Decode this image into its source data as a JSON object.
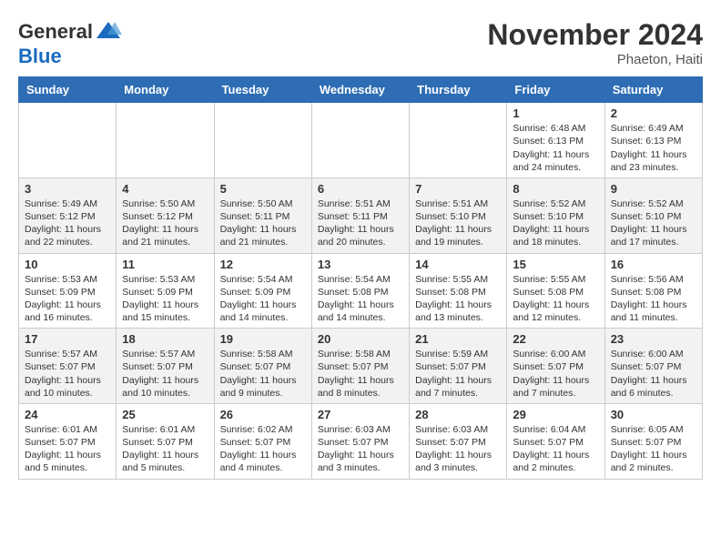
{
  "header": {
    "logo_line1": "General",
    "logo_line2": "Blue",
    "month_title": "November 2024",
    "location": "Phaeton, Haiti"
  },
  "weekdays": [
    "Sunday",
    "Monday",
    "Tuesday",
    "Wednesday",
    "Thursday",
    "Friday",
    "Saturday"
  ],
  "weeks": [
    [
      {
        "day": "",
        "detail": ""
      },
      {
        "day": "",
        "detail": ""
      },
      {
        "day": "",
        "detail": ""
      },
      {
        "day": "",
        "detail": ""
      },
      {
        "day": "",
        "detail": ""
      },
      {
        "day": "1",
        "detail": "Sunrise: 6:48 AM\nSunset: 6:13 PM\nDaylight: 11 hours\nand 24 minutes."
      },
      {
        "day": "2",
        "detail": "Sunrise: 6:49 AM\nSunset: 6:13 PM\nDaylight: 11 hours\nand 23 minutes."
      }
    ],
    [
      {
        "day": "3",
        "detail": "Sunrise: 5:49 AM\nSunset: 5:12 PM\nDaylight: 11 hours\nand 22 minutes."
      },
      {
        "day": "4",
        "detail": "Sunrise: 5:50 AM\nSunset: 5:12 PM\nDaylight: 11 hours\nand 21 minutes."
      },
      {
        "day": "5",
        "detail": "Sunrise: 5:50 AM\nSunset: 5:11 PM\nDaylight: 11 hours\nand 21 minutes."
      },
      {
        "day": "6",
        "detail": "Sunrise: 5:51 AM\nSunset: 5:11 PM\nDaylight: 11 hours\nand 20 minutes."
      },
      {
        "day": "7",
        "detail": "Sunrise: 5:51 AM\nSunset: 5:10 PM\nDaylight: 11 hours\nand 19 minutes."
      },
      {
        "day": "8",
        "detail": "Sunrise: 5:52 AM\nSunset: 5:10 PM\nDaylight: 11 hours\nand 18 minutes."
      },
      {
        "day": "9",
        "detail": "Sunrise: 5:52 AM\nSunset: 5:10 PM\nDaylight: 11 hours\nand 17 minutes."
      }
    ],
    [
      {
        "day": "10",
        "detail": "Sunrise: 5:53 AM\nSunset: 5:09 PM\nDaylight: 11 hours\nand 16 minutes."
      },
      {
        "day": "11",
        "detail": "Sunrise: 5:53 AM\nSunset: 5:09 PM\nDaylight: 11 hours\nand 15 minutes."
      },
      {
        "day": "12",
        "detail": "Sunrise: 5:54 AM\nSunset: 5:09 PM\nDaylight: 11 hours\nand 14 minutes."
      },
      {
        "day": "13",
        "detail": "Sunrise: 5:54 AM\nSunset: 5:08 PM\nDaylight: 11 hours\nand 14 minutes."
      },
      {
        "day": "14",
        "detail": "Sunrise: 5:55 AM\nSunset: 5:08 PM\nDaylight: 11 hours\nand 13 minutes."
      },
      {
        "day": "15",
        "detail": "Sunrise: 5:55 AM\nSunset: 5:08 PM\nDaylight: 11 hours\nand 12 minutes."
      },
      {
        "day": "16",
        "detail": "Sunrise: 5:56 AM\nSunset: 5:08 PM\nDaylight: 11 hours\nand 11 minutes."
      }
    ],
    [
      {
        "day": "17",
        "detail": "Sunrise: 5:57 AM\nSunset: 5:07 PM\nDaylight: 11 hours\nand 10 minutes."
      },
      {
        "day": "18",
        "detail": "Sunrise: 5:57 AM\nSunset: 5:07 PM\nDaylight: 11 hours\nand 10 minutes."
      },
      {
        "day": "19",
        "detail": "Sunrise: 5:58 AM\nSunset: 5:07 PM\nDaylight: 11 hours\nand 9 minutes."
      },
      {
        "day": "20",
        "detail": "Sunrise: 5:58 AM\nSunset: 5:07 PM\nDaylight: 11 hours\nand 8 minutes."
      },
      {
        "day": "21",
        "detail": "Sunrise: 5:59 AM\nSunset: 5:07 PM\nDaylight: 11 hours\nand 7 minutes."
      },
      {
        "day": "22",
        "detail": "Sunrise: 6:00 AM\nSunset: 5:07 PM\nDaylight: 11 hours\nand 7 minutes."
      },
      {
        "day": "23",
        "detail": "Sunrise: 6:00 AM\nSunset: 5:07 PM\nDaylight: 11 hours\nand 6 minutes."
      }
    ],
    [
      {
        "day": "24",
        "detail": "Sunrise: 6:01 AM\nSunset: 5:07 PM\nDaylight: 11 hours\nand 5 minutes."
      },
      {
        "day": "25",
        "detail": "Sunrise: 6:01 AM\nSunset: 5:07 PM\nDaylight: 11 hours\nand 5 minutes."
      },
      {
        "day": "26",
        "detail": "Sunrise: 6:02 AM\nSunset: 5:07 PM\nDaylight: 11 hours\nand 4 minutes."
      },
      {
        "day": "27",
        "detail": "Sunrise: 6:03 AM\nSunset: 5:07 PM\nDaylight: 11 hours\nand 3 minutes."
      },
      {
        "day": "28",
        "detail": "Sunrise: 6:03 AM\nSunset: 5:07 PM\nDaylight: 11 hours\nand 3 minutes."
      },
      {
        "day": "29",
        "detail": "Sunrise: 6:04 AM\nSunset: 5:07 PM\nDaylight: 11 hours\nand 2 minutes."
      },
      {
        "day": "30",
        "detail": "Sunrise: 6:05 AM\nSunset: 5:07 PM\nDaylight: 11 hours\nand 2 minutes."
      }
    ]
  ]
}
